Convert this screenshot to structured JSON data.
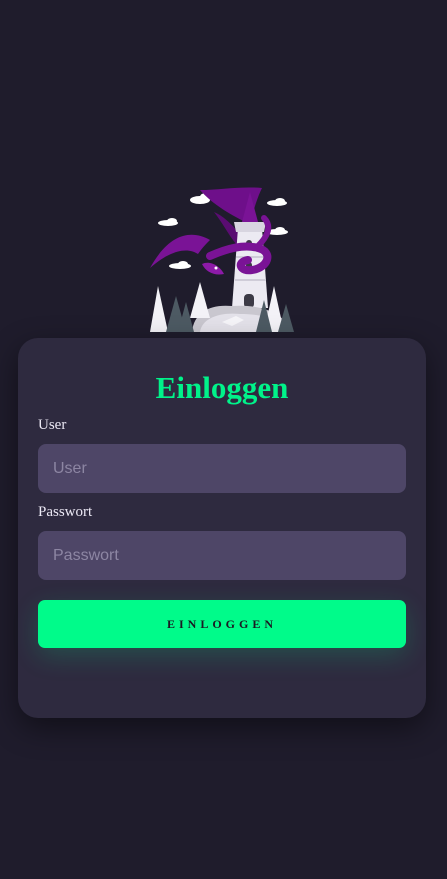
{
  "login": {
    "title": "Einloggen",
    "user_label": "User",
    "user_placeholder": "User",
    "user_value": "",
    "password_label": "Passwort",
    "password_placeholder": "Passwort",
    "password_value": "",
    "submit_label": "EINLOGGEN"
  },
  "illustration": {
    "icon": "dragon-tower-illustration"
  },
  "colors": {
    "background": "#1f1c2c",
    "card": "#2e2a3f",
    "input": "#4e4667",
    "accent": "#00fb8a",
    "dragon": "#7a1396"
  }
}
